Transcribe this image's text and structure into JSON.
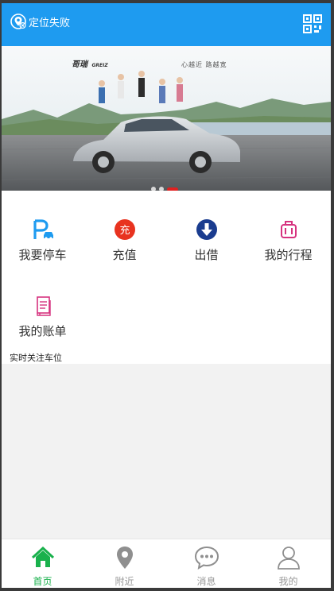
{
  "header": {
    "location_status": "定位失败",
    "location_icon": "location-fail-icon",
    "scan_icon": "qr-scan-icon",
    "bg_color": "#1e9bf0"
  },
  "banner": {
    "brand": "哥瑞",
    "brand_sub": "GREIZ",
    "slogan": "心越近 路越宽",
    "slide_count": 3,
    "active_slide": 3
  },
  "quick_actions": [
    {
      "label": "我要停车",
      "icon": "parking-car-icon"
    },
    {
      "label": "充值",
      "icon": "recharge-icon"
    },
    {
      "label": "出借",
      "icon": "lend-download-icon"
    },
    {
      "label": "我的行程",
      "icon": "luggage-trip-icon"
    },
    {
      "label": "我的账单",
      "icon": "bill-document-icon"
    }
  ],
  "section": {
    "title": "实时关注车位"
  },
  "tabbar": {
    "active_color": "#19b14c",
    "items": [
      {
        "label": "首页",
        "icon": "home-icon",
        "active": true
      },
      {
        "label": "附近",
        "icon": "map-pin-icon",
        "active": false
      },
      {
        "label": "消息",
        "icon": "chat-bubble-icon",
        "active": false
      },
      {
        "label": "我的",
        "icon": "user-profile-icon",
        "active": false
      }
    ]
  }
}
